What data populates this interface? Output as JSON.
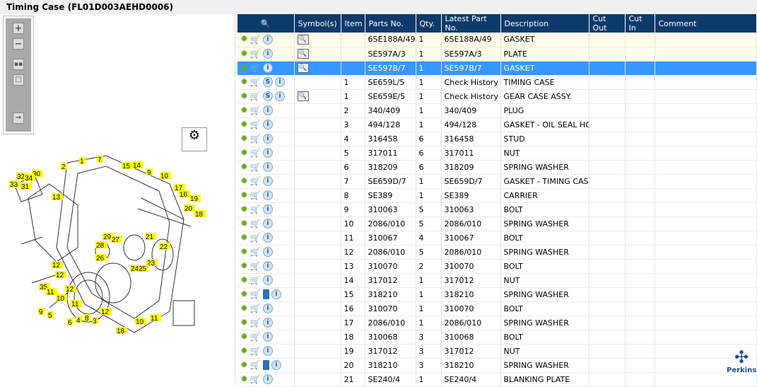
{
  "title": "Timing Case (FL01D003AEHD0006)",
  "columns": [
    "",
    "Symbol(s)",
    "Item",
    "Parts No.",
    "Qty.",
    "Latest Part No.",
    "Description",
    "Cut Out",
    "Cut In",
    "Comment"
  ],
  "rows": [
    {
      "item": "",
      "part": "6SE188A/49",
      "qty": "1",
      "latest": "6SE188A/49",
      "desc": "GASKET",
      "s": false,
      "book": false,
      "sym": true,
      "state": "hl"
    },
    {
      "item": "",
      "part": "SE597A/3",
      "qty": "1",
      "latest": "SE597A/3",
      "desc": "PLATE",
      "s": false,
      "book": false,
      "sym": true,
      "state": "hl"
    },
    {
      "item": "",
      "part": "SE597B/7",
      "qty": "1",
      "latest": "SE597B/7",
      "desc": "GASKET",
      "s": false,
      "book": false,
      "sym": true,
      "state": "sel"
    },
    {
      "item": "1",
      "part": "SE659L/5",
      "qty": "1",
      "latest": "Check History",
      "desc": "TIMING CASE",
      "s": true,
      "book": false,
      "sym": false,
      "state": ""
    },
    {
      "item": "1",
      "part": "SE659E/5",
      "qty": "1",
      "latest": "Check History",
      "desc": "GEAR CASE ASSY.",
      "s": true,
      "book": false,
      "sym": true,
      "state": ""
    },
    {
      "item": "2",
      "part": "340/409",
      "qty": "1",
      "latest": "340/409",
      "desc": "PLUG",
      "s": false,
      "book": false,
      "sym": false,
      "state": ""
    },
    {
      "item": "3",
      "part": "494/128",
      "qty": "1",
      "latest": "494/128",
      "desc": "GASKET - OIL SEAL HOU",
      "s": false,
      "book": false,
      "sym": false,
      "state": ""
    },
    {
      "item": "4",
      "part": "316458",
      "qty": "6",
      "latest": "316458",
      "desc": "STUD",
      "s": false,
      "book": false,
      "sym": false,
      "state": ""
    },
    {
      "item": "5",
      "part": "317011",
      "qty": "6",
      "latest": "317011",
      "desc": "NUT",
      "s": false,
      "book": false,
      "sym": false,
      "state": ""
    },
    {
      "item": "6",
      "part": "318209",
      "qty": "6",
      "latest": "318209",
      "desc": "SPRING WASHER",
      "s": false,
      "book": false,
      "sym": false,
      "state": ""
    },
    {
      "item": "7",
      "part": "SE659D/7",
      "qty": "1",
      "latest": "SE659D/7",
      "desc": "GASKET - TIMING CASE",
      "s": false,
      "book": false,
      "sym": false,
      "state": ""
    },
    {
      "item": "8",
      "part": "SE389",
      "qty": "1",
      "latest": "SE389",
      "desc": "CARRIER",
      "s": false,
      "book": false,
      "sym": false,
      "state": ""
    },
    {
      "item": "9",
      "part": "310063",
      "qty": "5",
      "latest": "310063",
      "desc": "BOLT",
      "s": false,
      "book": false,
      "sym": false,
      "state": ""
    },
    {
      "item": "10",
      "part": "2086/010",
      "qty": "5",
      "latest": "2086/010",
      "desc": "SPRING WASHER",
      "s": false,
      "book": false,
      "sym": false,
      "state": ""
    },
    {
      "item": "11",
      "part": "310067",
      "qty": "4",
      "latest": "310067",
      "desc": "BOLT",
      "s": false,
      "book": false,
      "sym": false,
      "state": ""
    },
    {
      "item": "12",
      "part": "2086/010",
      "qty": "5",
      "latest": "2086/010",
      "desc": "SPRING WASHER",
      "s": false,
      "book": false,
      "sym": false,
      "state": ""
    },
    {
      "item": "13",
      "part": "310070",
      "qty": "2",
      "latest": "310070",
      "desc": "BOLT",
      "s": false,
      "book": false,
      "sym": false,
      "state": ""
    },
    {
      "item": "14",
      "part": "317012",
      "qty": "1",
      "latest": "317012",
      "desc": "NUT",
      "s": false,
      "book": false,
      "sym": false,
      "state": ""
    },
    {
      "item": "15",
      "part": "318210",
      "qty": "1",
      "latest": "318210",
      "desc": "SPRING WASHER",
      "s": false,
      "book": true,
      "sym": false,
      "state": ""
    },
    {
      "item": "16",
      "part": "310070",
      "qty": "1",
      "latest": "310070",
      "desc": "BOLT",
      "s": false,
      "book": false,
      "sym": false,
      "state": ""
    },
    {
      "item": "17",
      "part": "2086/010",
      "qty": "1",
      "latest": "2086/010",
      "desc": "SPRING WASHER",
      "s": false,
      "book": false,
      "sym": false,
      "state": ""
    },
    {
      "item": "18",
      "part": "310068",
      "qty": "3",
      "latest": "310068",
      "desc": "BOLT",
      "s": false,
      "book": false,
      "sym": false,
      "state": ""
    },
    {
      "item": "19",
      "part": "317012",
      "qty": "3",
      "latest": "317012",
      "desc": "NUT",
      "s": false,
      "book": false,
      "sym": false,
      "state": ""
    },
    {
      "item": "20",
      "part": "318210",
      "qty": "3",
      "latest": "318210",
      "desc": "SPRING WASHER",
      "s": false,
      "book": true,
      "sym": false,
      "state": ""
    },
    {
      "item": "21",
      "part": "SE240/4",
      "qty": "1",
      "latest": "SE240/4",
      "desc": "BLANKING PLATE",
      "s": false,
      "book": false,
      "sym": false,
      "state": ""
    }
  ],
  "callouts": [
    "2",
    "1",
    "7",
    "15",
    "14",
    "9",
    "10",
    "30",
    "32",
    "34",
    "33",
    "31",
    "13",
    "17",
    "16",
    "19",
    "20",
    "18",
    "29",
    "27",
    "28",
    "21",
    "22",
    "26",
    "23",
    "24",
    "25",
    "12",
    "12",
    "35",
    "11",
    "12",
    "10",
    "11",
    "9",
    "5",
    "6",
    "4",
    "8",
    "3",
    "12",
    "10",
    "11",
    "18"
  ],
  "logo": "Perkins"
}
